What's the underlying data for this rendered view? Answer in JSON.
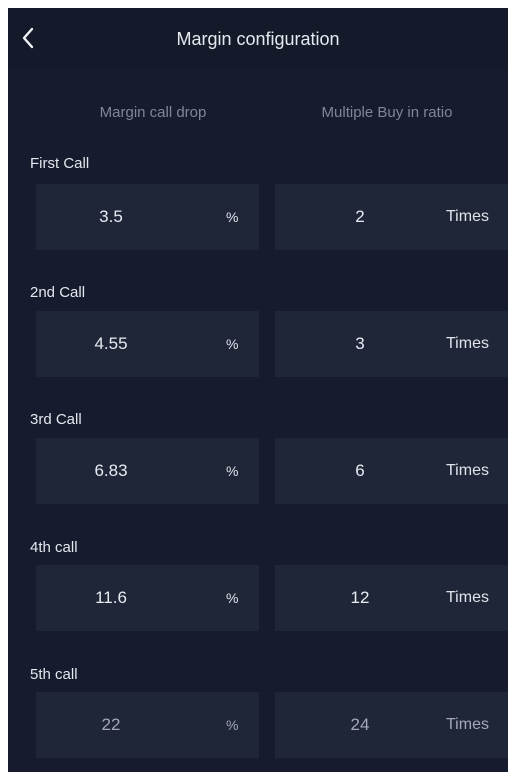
{
  "header": {
    "title": "Margin configuration",
    "back_icon": "chevron-left-icon"
  },
  "columns": {
    "drop": "Margin call drop",
    "ratio": "Multiple Buy in ratio"
  },
  "calls": [
    {
      "label": "First Call",
      "drop": "3.5",
      "drop_unit": "%",
      "ratio": "2",
      "ratio_unit": "Times"
    },
    {
      "label": "2nd Call",
      "drop": "4.55",
      "drop_unit": "%",
      "ratio": "3",
      "ratio_unit": "Times"
    },
    {
      "label": "3rd Call",
      "drop": "6.83",
      "drop_unit": "%",
      "ratio": "6",
      "ratio_unit": "Times"
    },
    {
      "label": "4th call",
      "drop": "11.6",
      "drop_unit": "%",
      "ratio": "12",
      "ratio_unit": "Times"
    },
    {
      "label": "5th call",
      "drop": "22",
      "drop_unit": "%",
      "ratio": "24",
      "ratio_unit": "Times"
    }
  ],
  "colors": {
    "background": "#161c2d",
    "field": "#1f2637",
    "text": "#e8ebf2",
    "muted_text": "#7e8699"
  }
}
